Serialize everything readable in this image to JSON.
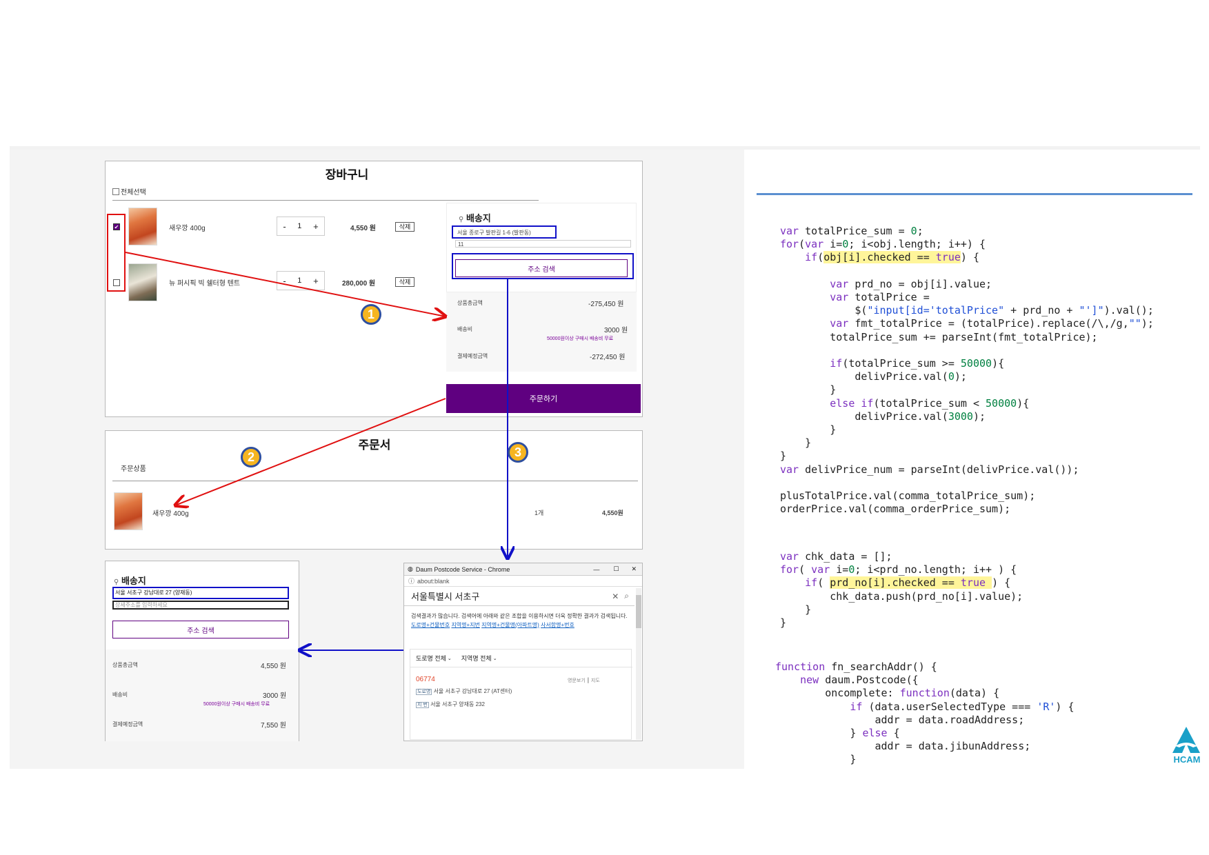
{
  "cart": {
    "title": "장바구니",
    "select_all": "전체선택",
    "items": [
      {
        "name": "새우깡 400g",
        "qty": "1",
        "price": "4,550 원",
        "delete": "삭제",
        "checked": true
      },
      {
        "name": "뉴 퍼시픽 빅 쉘터형 텐트",
        "qty": "1",
        "price": "280,000 원",
        "delete": "삭제",
        "checked": false
      }
    ],
    "minus": "-",
    "plus": "+",
    "delivery": {
      "heading": "배송지",
      "address": "서울 종로구 발판길 1-6 (발판동)",
      "detail": "11",
      "search_button": "주소 검색"
    },
    "summary": {
      "total_label": "상품총금액",
      "total_value": "-275,450 원",
      "shipping_label": "배송비",
      "shipping_value": "3000 원",
      "shipping_note": "50000원이상 구매시 배송비 무료",
      "pay_label": "결제예정금액",
      "pay_value": "-272,450 원"
    },
    "order_button": "주문하기"
  },
  "order_form": {
    "title": "주문서",
    "section": "주문상품",
    "item_name": "새우깡 400g",
    "item_qty": "1개",
    "item_price": "4,550원"
  },
  "delivery2": {
    "heading": "배송지",
    "address": "서울 서초구 강남대로 27 (양재동)",
    "detail_placeholder": "상세주소를 입력하세요",
    "search_button": "주소 검색",
    "total_label": "상품총금액",
    "total_value": "4,550 원",
    "shipping_label": "배송비",
    "shipping_value": "3000 원",
    "shipping_note": "50000원이상 구매시 배송비 무료",
    "pay_label": "결제예정금액",
    "pay_value": "7,550 원"
  },
  "postcode": {
    "window_title": "Daum Postcode Service - Chrome",
    "url": "about:blank",
    "query": "서울특별시 서초구",
    "notice": "검색결과가 많습니다. 검색어에 아래와 같은 조합을 이용하시면 더욱 정확한 결과가 검색됩니다.",
    "links": [
      "도로명+건물번호",
      "지역명+지번",
      "지역명+건물명(아파트명)",
      "사서함명+번호"
    ],
    "filter_road": "도로명 전체",
    "filter_area": "지역명 전체",
    "result_zip": "06774",
    "result_road_tag": "도로명",
    "result_road": "서울 서초구 강남대로 27 (AT센터)",
    "result_jibun_tag": "지 번",
    "result_jibun": "서울 서초구 양재동 232",
    "eng_view": "영문보기",
    "map": "지도"
  },
  "steps": [
    "1",
    "2",
    "3"
  ],
  "logo": {
    "text": "HCAM",
    "color": "#1aa0c8"
  },
  "colors": {
    "accent": "#5f0080",
    "arrow_red": "#e01010",
    "arrow_blue": "#1010c8",
    "badge": "#f6b520",
    "rule": "#5b8fd0"
  }
}
